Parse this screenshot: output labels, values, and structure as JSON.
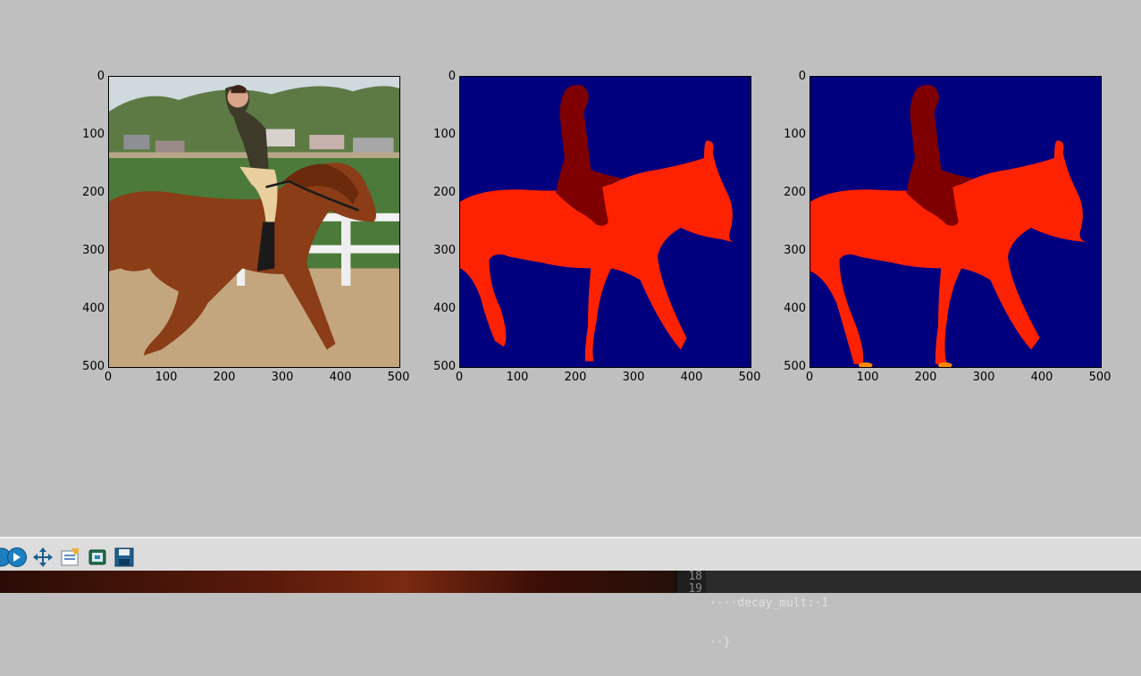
{
  "figure": {
    "panels": [
      {
        "name": "input-image",
        "kind": "photo"
      },
      {
        "name": "ground-truth-segmentation",
        "kind": "segmentation"
      },
      {
        "name": "predicted-segmentation",
        "kind": "segmentation"
      }
    ],
    "y_ticks": [
      "0",
      "100",
      "200",
      "300",
      "400",
      "500"
    ],
    "x_ticks": [
      "0",
      "100",
      "200",
      "300",
      "400",
      "500"
    ],
    "colors": {
      "background_class": "#00007f",
      "person_class": "#7f0000",
      "horse_class": "#ff2200",
      "misc_class": "#ff8800",
      "figure_bg": "#bfbfbf"
    }
  },
  "toolbar": {
    "buttons": [
      {
        "name": "forward-button",
        "icon": "forward-arrow-icon"
      },
      {
        "name": "pan-button",
        "icon": "move-arrows-icon"
      },
      {
        "name": "configure-subplots-button",
        "icon": "subplots-config-icon"
      },
      {
        "name": "edit-axes-button",
        "icon": "edit-icon"
      },
      {
        "name": "save-button",
        "icon": "floppy-disk-icon"
      }
    ]
  },
  "editor": {
    "line_numbers": [
      "18",
      "19"
    ],
    "lines": [
      "····decay_mult:·1",
      "··}"
    ]
  }
}
